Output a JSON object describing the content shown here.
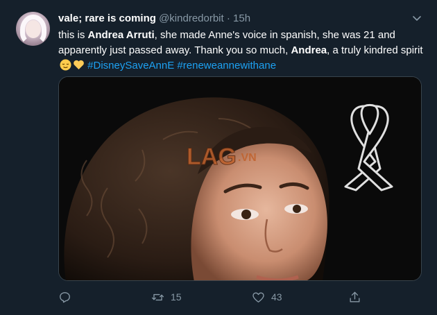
{
  "tweet": {
    "display_name": "vale; rare is coming",
    "handle": "@kindredorbit",
    "separator": "·",
    "time": "15h",
    "text": {
      "part1": "this is ",
      "bold1": "Andrea Arruti",
      "part2": ", she made Anne's voice in spanish, she was 21 and apparently just passed away. Thank you so much, ",
      "bold2": "Andrea",
      "part3": ", a truly kindred spirit ",
      "hashtag1": "#DisneySaveAnnE",
      "hashtag2": "#reneweannewithane"
    },
    "emojis": [
      "relieved-face-emoji",
      "yellow-heart-emoji"
    ],
    "media": {
      "watermark": "LAG.VN",
      "icon": "black-mourning-ribbon"
    },
    "actions": {
      "reply_count": "",
      "retweet_count": "15",
      "like_count": "43"
    }
  },
  "colors": {
    "background": "#15202b",
    "secondary_text": "#8899a6",
    "link": "#1da1f2",
    "border": "#38444d"
  }
}
